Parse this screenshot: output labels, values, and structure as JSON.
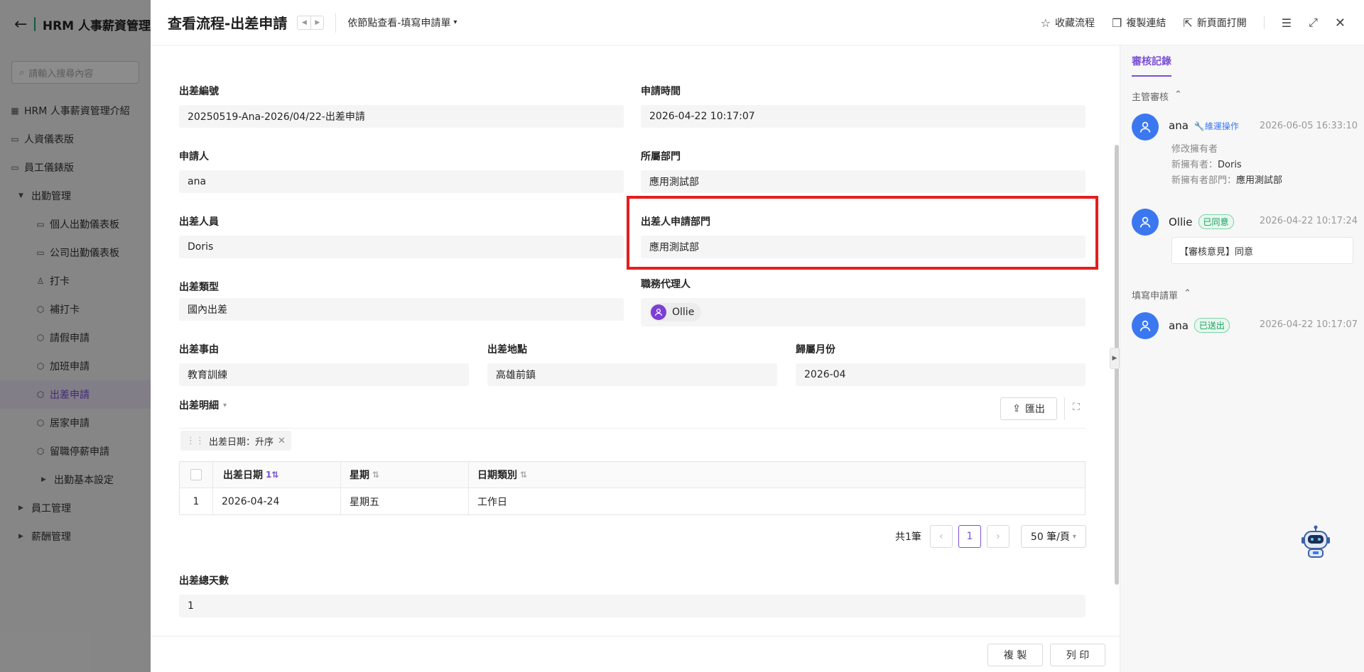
{
  "background_app": {
    "title": "HRM 人事薪資管理",
    "search_placeholder": "請輸入搜尋內容",
    "nav": [
      {
        "label": "HRM 人事薪資管理介紹",
        "level": 1
      },
      {
        "label": "人資儀表版",
        "level": 1
      },
      {
        "label": "員工儀錶版",
        "level": 1
      },
      {
        "label": "出勤管理",
        "level": 1
      },
      {
        "label": "個人出勤儀表板",
        "level": 2
      },
      {
        "label": "公司出勤儀表板",
        "level": 2
      },
      {
        "label": "打卡",
        "level": 2
      },
      {
        "label": "補打卡",
        "level": 2
      },
      {
        "label": "請假申請",
        "level": 2
      },
      {
        "label": "加班申請",
        "level": 2
      },
      {
        "label": "出差申請",
        "level": 2,
        "active": true
      },
      {
        "label": "居家申請",
        "level": 2
      },
      {
        "label": "留職停薪申請",
        "level": 2
      },
      {
        "label": "出勤基本設定",
        "level": 3
      },
      {
        "label": "員工管理",
        "level": 1
      },
      {
        "label": "薪酬管理",
        "level": 1
      }
    ]
  },
  "header": {
    "title": "查看流程-出差申請",
    "view_select": "依節點查看-填寫申請單",
    "actions": {
      "favorite": "收藏流程",
      "copy_link": "複製連結",
      "open_new": "新頁面打開"
    }
  },
  "form": {
    "trip_no": {
      "label": "出差編號",
      "value": "20250519-Ana-2026/04/22-出差申請"
    },
    "apply_time": {
      "label": "申請時間",
      "value": "2026-04-22 10:17:07"
    },
    "applicant": {
      "label": "申請人",
      "value": "ana"
    },
    "dept": {
      "label": "所屬部門",
      "value": "應用測試部"
    },
    "traveler": {
      "label": "出差人員",
      "value": "Doris"
    },
    "traveler_dept": {
      "label": "出差人申請部門",
      "value": "應用測試部"
    },
    "trip_type": {
      "label": "出差類型",
      "value": "國內出差"
    },
    "agent": {
      "label": "職務代理人",
      "value": "Ollie"
    },
    "reason": {
      "label": "出差事由",
      "value": "教育訓練"
    },
    "location": {
      "label": "出差地點",
      "value": "高雄前鎮"
    },
    "month": {
      "label": "歸屬月份",
      "value": "2026-04"
    },
    "total_days": {
      "label": "出差總天數",
      "value": "1"
    }
  },
  "detail": {
    "title": "出差明細",
    "export_label": "匯出",
    "sort_chip": "出差日期：升序",
    "columns": [
      "出差日期",
      "星期",
      "日期類別"
    ],
    "sort_badge": "1",
    "rows": [
      {
        "index": "1",
        "date": "2026-04-24",
        "weekday": "星期五",
        "type": "工作日"
      }
    ],
    "pagination": {
      "total": "共1筆",
      "current": "1",
      "size": "50 筆/頁"
    }
  },
  "side": {
    "tab": "審核記錄",
    "sections": [
      {
        "title": "主管審核",
        "records": [
          {
            "name": "ana",
            "tag": "維運操作",
            "time": "2026-06-05 16:33:10",
            "line1": "修改擁有者",
            "line2_label": "新擁有者：",
            "line2_value": "Doris",
            "line3_label": "新擁有者部門：",
            "line3_value": "應用測試部"
          },
          {
            "name": "Ollie",
            "tag": "已同意",
            "time": "2026-04-22 10:17:24",
            "opinion": "【審核意見】同意"
          }
        ]
      },
      {
        "title": "填寫申請單",
        "records": [
          {
            "name": "ana",
            "tag": "已送出",
            "time": "2026-04-22 10:17:07"
          }
        ]
      }
    ]
  },
  "footer": {
    "copy": "複 製",
    "print": "列 印"
  },
  "colors": {
    "accent": "#7b4fd6",
    "highlight": "#e41e1e",
    "avatar_blue": "#3b78f0",
    "success": "#17a05d"
  }
}
